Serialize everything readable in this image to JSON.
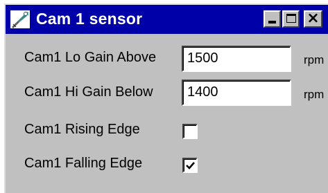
{
  "window": {
    "title": "Cam 1 sensor",
    "icon": "wrench-icon",
    "buttons": {
      "minimize_icon": "minimize-icon",
      "maximize_icon": "maximize-icon",
      "close_icon": "close-icon"
    }
  },
  "fields": [
    {
      "label": "Cam1 Lo Gain Above",
      "value": "1500",
      "unit": "rpm"
    },
    {
      "label": "Cam1 Hi Gain Below",
      "value": "1400",
      "unit": "rpm"
    }
  ],
  "checkboxes": [
    {
      "label": "Cam1 Rising Edge",
      "checked": false
    },
    {
      "label": "Cam1 Falling Edge",
      "checked": true
    }
  ],
  "colors": {
    "titlebar": "#0000a8",
    "face": "#c0c0c0"
  }
}
